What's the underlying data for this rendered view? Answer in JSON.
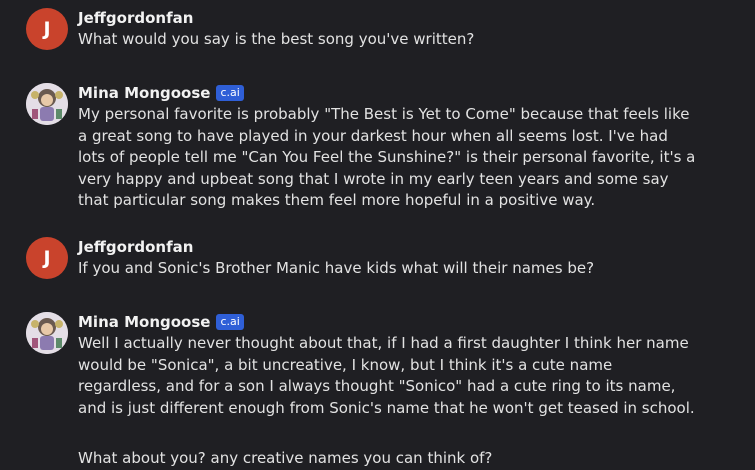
{
  "messages": [
    {
      "author": "Jeffgordonfan",
      "avatar_letter": "J",
      "text": "What would you say is the best song you've written?"
    },
    {
      "author": "Mina Mongoose",
      "badge": "c.ai",
      "text": "My personal favorite is probably \"The Best is Yet to Come\" because that feels like a great song to have played in your darkest hour when all seems lost. I've had lots of people tell me \"Can You Feel the Sunshine?\" is their personal favorite, it's a very happy and upbeat song that I wrote in my early teen years and some say that particular song makes them feel more hopeful in a positive way."
    },
    {
      "author": "Jeffgordonfan",
      "avatar_letter": "J",
      "text": "If you and Sonic's Brother Manic have kids what will their names be?"
    },
    {
      "author": "Mina Mongoose",
      "badge": "c.ai",
      "text": "Well I actually never thought about that, if I had a first daughter I think her name would be \"Sonica\", a bit uncreative, I know, but I think it's a cute name regardless, and for a son I always thought \"Sonico\" had a cute ring to its name, and is just different enough from Sonic's name that he won't get teased in school.",
      "text2": "What about you? any creative names you can think of?"
    }
  ]
}
